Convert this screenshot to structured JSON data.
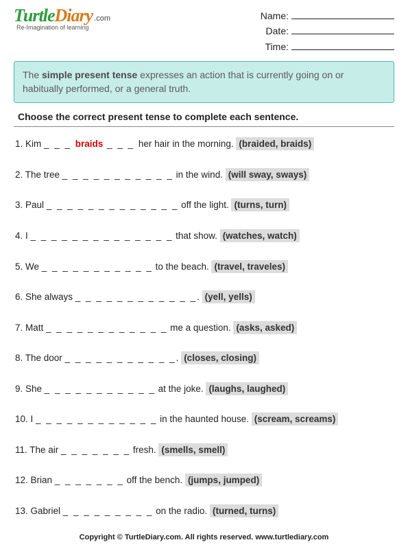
{
  "logo": {
    "turtle": "Turtle",
    "diary": "Diary",
    "com": ".com",
    "tagline": "Re-Imagination of learning"
  },
  "fields": {
    "name": "Name:",
    "date": "Date:",
    "time": "Time:"
  },
  "infobox": {
    "pre": "The ",
    "bold": "simple present tense",
    "post": " expresses an action that is currently going on or habitually performed, or a general truth."
  },
  "instruction": "Choose the correct present tense to complete each sentence.",
  "questions": [
    {
      "num": "1.",
      "pre": "Kim ",
      "blank_pre": "_ _ _ ",
      "answer": "braids",
      "blank_post": " _ _ _ ",
      "post": " her hair in the morning.  ",
      "choices": "(braided, braids)"
    },
    {
      "num": "2.",
      "pre": "The tree ",
      "blank": "_ _ _ _ _ _ _ _ _ _ _",
      "post": " in the wind.  ",
      "choices": "(will sway, sways)"
    },
    {
      "num": "3.",
      "pre": "Paul ",
      "blank": "_ _ _ _ _ _ _ _ _ _ _ _ _",
      "post": " off the light.  ",
      "choices": "(turns, turn)"
    },
    {
      "num": "4.",
      "pre": "I ",
      "blank": "_ _ _ _ _ _ _ _ _ _ _ _ _ _",
      "post": " that show.  ",
      "choices": "(watches, watch)"
    },
    {
      "num": "5.",
      "pre": "We ",
      "blank": "_ _ _ _ _ _ _ _ _ _ _",
      "post": " to the beach.  ",
      "choices": "(travel, traveles)"
    },
    {
      "num": "6.",
      "pre": "She always ",
      "blank": "_ _ _ _ _ _ _ _ _ _ _ _",
      "post": ".  ",
      "choices": "(yell, yells)"
    },
    {
      "num": "7.",
      "pre": "Matt ",
      "blank": "_ _ _ _ _ _ _ _ _ _ _ _",
      "post": " me a question.  ",
      "choices": "(asks, asked)"
    },
    {
      "num": "8.",
      "pre": "The door ",
      "blank": "_ _ _ _ _ _ _ _ _ _ _",
      "post": ".  ",
      "choices": "(closes, closing)"
    },
    {
      "num": "9.",
      "pre": "She ",
      "blank": "_ _ _ _ _ _ _ _ _ _ _",
      "post": " at the joke.  ",
      "choices": "(laughs, laughed)"
    },
    {
      "num": "10.",
      "pre": "I ",
      "blank": "_ _ _ _ _ _ _ _ _ _ _ _",
      "post": " in the haunted house.  ",
      "choices": "(scream, screams)"
    },
    {
      "num": "11.",
      "pre": "The air ",
      "blank": "_ _ _ _ _ _ _",
      "post": " fresh.  ",
      "choices": "(smells, smell)"
    },
    {
      "num": "12.",
      "pre": "Brian ",
      "blank": "_ _ _ _ _ _ _",
      "post": " off the bench.  ",
      "choices": "(jumps, jumped)"
    },
    {
      "num": "13.",
      "pre": "Gabriel ",
      "blank": "_ _ _ _ _ _ _ _ _",
      "post": " on the radio.  ",
      "choices": "(turned, turns)"
    }
  ],
  "footer": "Copyright © TurtleDiary.com. All rights reserved. www.turtlediary.com"
}
